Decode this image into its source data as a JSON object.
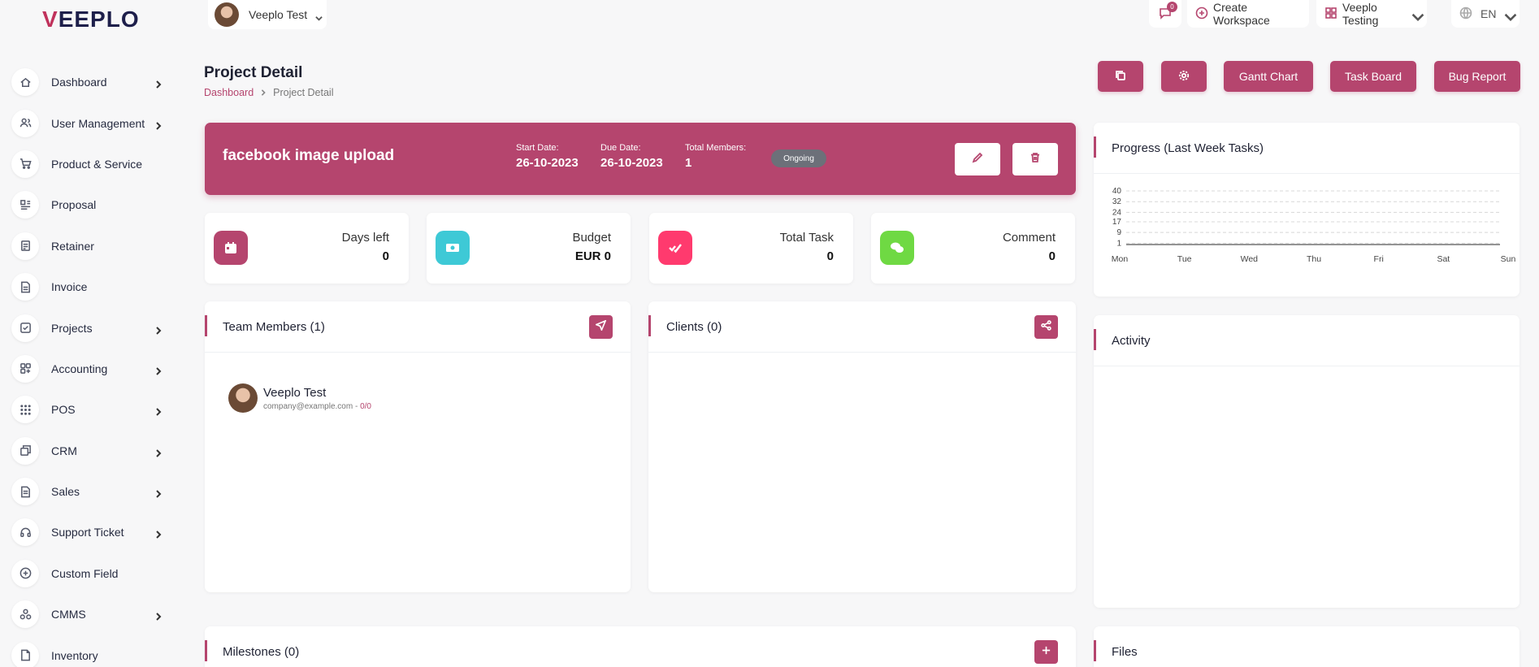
{
  "brand": {
    "logo_text": "EEPLO",
    "logo_v": "V"
  },
  "sidebar": {
    "items": [
      {
        "label": "Dashboard",
        "icon": "home-icon",
        "chevron": true
      },
      {
        "label": "User Management",
        "icon": "users-icon",
        "chevron": true
      },
      {
        "label": "Product & Service",
        "icon": "cart-icon",
        "chevron": false
      },
      {
        "label": "Proposal",
        "icon": "proposal-icon",
        "chevron": false
      },
      {
        "label": "Retainer",
        "icon": "retainer-icon",
        "chevron": false
      },
      {
        "label": "Invoice",
        "icon": "invoice-icon",
        "chevron": false
      },
      {
        "label": "Projects",
        "icon": "projects-icon",
        "chevron": true
      },
      {
        "label": "Accounting",
        "icon": "accounting-icon",
        "chevron": true
      },
      {
        "label": "POS",
        "icon": "grid-icon",
        "chevron": true
      },
      {
        "label": "CRM",
        "icon": "crm-icon",
        "chevron": true
      },
      {
        "label": "Sales",
        "icon": "sales-icon",
        "chevron": true
      },
      {
        "label": "Support Ticket",
        "icon": "headset-icon",
        "chevron": true
      },
      {
        "label": "Custom Field",
        "icon": "plus-circle-icon",
        "chevron": false
      },
      {
        "label": "CMMS",
        "icon": "cmms-icon",
        "chevron": true
      },
      {
        "label": "Inventory",
        "icon": "inventory-icon",
        "chevron": false
      }
    ]
  },
  "topbar": {
    "user_name": "Veeplo Test",
    "messages_count": "0",
    "create_workspace": "Create Workspace",
    "workspace_name": "Veeplo Testing",
    "language": "EN"
  },
  "page": {
    "title": "Project Detail",
    "breadcrumb": {
      "home": "Dashboard",
      "current": "Project Detail"
    },
    "buttons": {
      "gantt": "Gantt Chart",
      "task_board": "Task Board",
      "bug_report": "Bug Report"
    }
  },
  "project": {
    "name": "facebook image upload",
    "start_label": "Start Date:",
    "start_date": "26-10-2023",
    "due_label": "Due Date:",
    "due_date": "26-10-2023",
    "members_label": "Total Members:",
    "members_count": "1",
    "status": "Ongoing"
  },
  "stats": [
    {
      "label": "Days left",
      "value": "0",
      "color": "#b5456e",
      "icon": "calendar-icon"
    },
    {
      "label": "Budget",
      "value": "EUR 0",
      "color": "#3ec9d6",
      "icon": "money-icon"
    },
    {
      "label": "Total Task",
      "value": "0",
      "color": "#ff3a6e",
      "icon": "check-icon"
    },
    {
      "label": "Comment",
      "value": "0",
      "color": "#6fd943",
      "icon": "chat-icon"
    }
  ],
  "team": {
    "title": "Team Members (1)",
    "members": [
      {
        "name": "Veeplo Test",
        "email": "company@example.com",
        "ratio": "0/0"
      }
    ]
  },
  "clients": {
    "title": "Clients (0)"
  },
  "milestones": {
    "title": "Milestones (0)"
  },
  "progress": {
    "title": "Progress (Last Week Tasks)"
  },
  "activity": {
    "title": "Activity"
  },
  "files": {
    "title": "Files"
  },
  "chart_data": {
    "type": "line",
    "title": "Progress (Last Week Tasks)",
    "categories": [
      "Mon",
      "Tue",
      "Wed",
      "Thu",
      "Fri",
      "Sat",
      "Sun"
    ],
    "series": [
      {
        "values": [
          0,
          0,
          0,
          0,
          0,
          0,
          0
        ]
      }
    ],
    "yticks": [
      1,
      9,
      17,
      24,
      32,
      40
    ],
    "ylim": [
      0,
      40
    ],
    "grid": true,
    "legend": "none"
  },
  "colors": {
    "accent": "#b5456e",
    "status_pill": "#6c7079"
  }
}
